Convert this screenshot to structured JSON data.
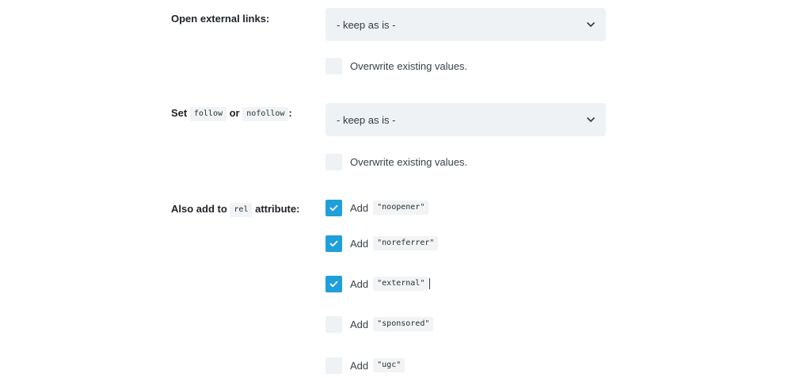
{
  "external_links": {
    "label": "Open external links:",
    "select_value": "- keep as is -",
    "overwrite_label": "Overwrite existing values."
  },
  "follow": {
    "label_prefix": "Set",
    "code_follow": "follow",
    "label_or": "or",
    "code_nofollow": "nofollow",
    "label_suffix": ":",
    "select_value": "- keep as is -",
    "overwrite_label": "Overwrite existing values."
  },
  "rel": {
    "label_prefix": "Also add to",
    "code_rel": "rel",
    "label_suffix": "attribute:",
    "options": [
      {
        "add": "Add",
        "value": "\"noopener\"",
        "checked": true
      },
      {
        "add": "Add",
        "value": "\"noreferrer\"",
        "checked": true
      },
      {
        "add": "Add",
        "value": "\"external\"",
        "checked": true
      },
      {
        "add": "Add",
        "value": "\"sponsored\"",
        "checked": false
      },
      {
        "add": "Add",
        "value": "\"ugc\"",
        "checked": false
      }
    ]
  },
  "icons": {
    "select_chevron": "chevron-down-icon",
    "checkbox_check": "check-icon"
  },
  "colors": {
    "checkbox_checked": "#1f9fdb",
    "field_background": "#eef2f5"
  }
}
